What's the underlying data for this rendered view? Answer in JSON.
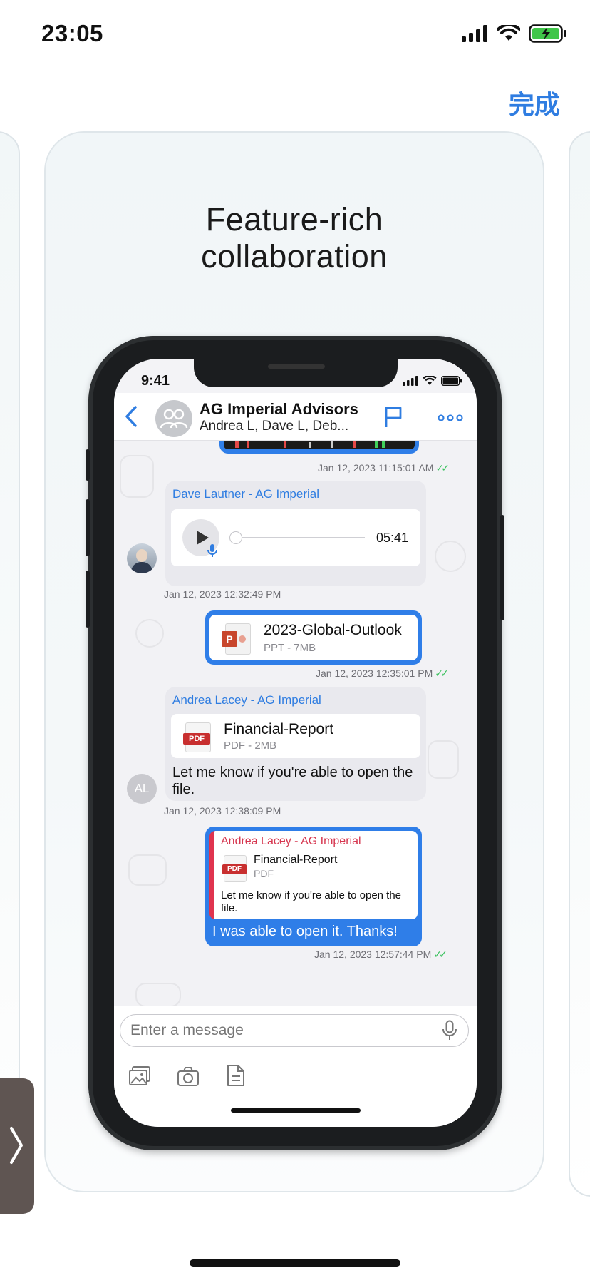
{
  "status": {
    "time": "23:05"
  },
  "nav": {
    "done_label": "完成"
  },
  "card": {
    "headline_line1": "Feature-rich",
    "headline_line2": "collaboration"
  },
  "phone": {
    "status_time": "9:41",
    "header": {
      "title": "AG Imperial Advisors",
      "subtitle": "Andrea L, Dave L, Deb..."
    },
    "messages": {
      "m0": {
        "timestamp": "Jan 12, 2023 11:15:01 AM"
      },
      "m1": {
        "sender": "Dave Lautner - AG Imperial",
        "duration": "05:41",
        "timestamp": "Jan 12, 2023 12:32:49 PM"
      },
      "m2": {
        "file_name": "2023-Global-Outlook",
        "file_meta": "PPT - 7MB",
        "timestamp": "Jan 12, 2023 12:35:01 PM"
      },
      "m3": {
        "sender": "Andrea Lacey - AG Imperial",
        "file_name": "Financial-Report",
        "file_meta": "PDF - 2MB",
        "text": "Let me know if you're able to open the file.",
        "avatar_initials": "AL",
        "timestamp": "Jan 12, 2023 12:38:09 PM"
      },
      "m4": {
        "quoted_sender": "Andrea Lacey - AG Imperial",
        "quoted_file_name": "Financial-Report",
        "quoted_file_meta": "PDF",
        "quoted_text": "Let me know if you're able to open the file.",
        "text": "I was able to open it. Thanks!",
        "timestamp": "Jan 12, 2023 12:57:44 PM"
      }
    },
    "composer": {
      "placeholder": "Enter a message"
    },
    "file_badges": {
      "ppt": "P",
      "pdf": "PDF"
    }
  },
  "colors": {
    "accent": "#2f7de1",
    "read_ticks": "#37c05b",
    "quote_bar": "#e0344f"
  },
  "icons": [
    "signal-icon",
    "wifi-icon",
    "battery-charging-icon",
    "back-chevron-icon",
    "group-avatar-icon",
    "flag-icon",
    "more-icon",
    "play-icon",
    "mic-icon",
    "gallery-icon",
    "camera-icon",
    "document-icon",
    "next-chevron-icon"
  ]
}
